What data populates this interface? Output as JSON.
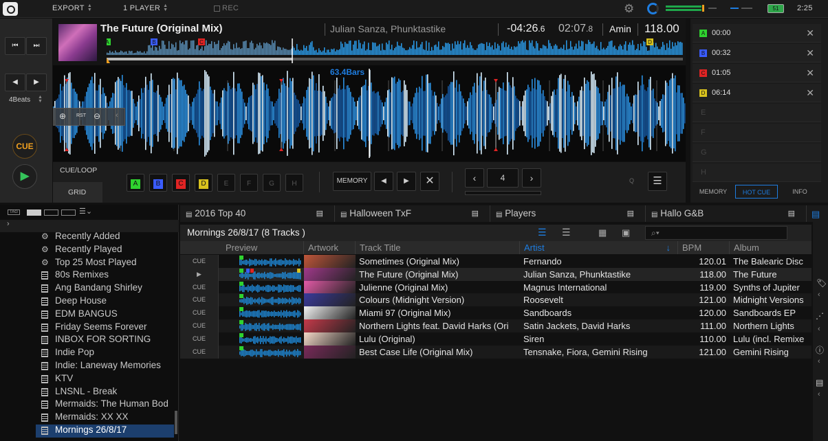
{
  "topbar": {
    "mode": "EXPORT",
    "players": "1 PLAYER",
    "rec": "REC",
    "clock": "2:25",
    "battery": "51"
  },
  "deck": {
    "beats_label": "4Beats",
    "cue_label": "CUE",
    "title": "The Future (Original Mix)",
    "artist": "Julian Sanza, Phunktastike",
    "remaining_main": "-04:26",
    "remaining_frac": ".6",
    "elapsed_main": "02:07",
    "elapsed_frac": ".8",
    "key": "Amin",
    "bpm": "118.00",
    "bars_label": "63.4Bars",
    "zoom_reset": "RST",
    "tabs": [
      "CUE/LOOP",
      "GRID"
    ],
    "hotcue_buttons": [
      "A",
      "B",
      "C",
      "D",
      "E",
      "F",
      "G",
      "H"
    ],
    "memory_label": "MEMORY",
    "loop_beats": "4",
    "q_label": "Q",
    "overview_markers": [
      "A",
      "B",
      "C",
      "D"
    ]
  },
  "hotcues": [
    {
      "letter": "A",
      "time": "00:00",
      "color": "#2fd22f"
    },
    {
      "letter": "B",
      "time": "00:32",
      "color": "#3a5cff"
    },
    {
      "letter": "C",
      "time": "01:05",
      "color": "#e02424"
    },
    {
      "letter": "D",
      "time": "06:14",
      "color": "#d8c21e"
    },
    {
      "letter": "E",
      "time": ""
    },
    {
      "letter": "F",
      "time": ""
    },
    {
      "letter": "G",
      "time": ""
    },
    {
      "letter": "H",
      "time": ""
    }
  ],
  "panel_tabs": [
    "MEMORY",
    "HOT CUE",
    "INFO"
  ],
  "tree": {
    "tag_label": "TAG",
    "items": [
      {
        "label": "Recently Added",
        "kind": "smart"
      },
      {
        "label": "Recently Played",
        "kind": "smart"
      },
      {
        "label": "Top 25 Most Played",
        "kind": "smart"
      },
      {
        "label": "80s Remixes",
        "kind": "list"
      },
      {
        "label": "Ang Bandang Shirley",
        "kind": "list"
      },
      {
        "label": "Deep House",
        "kind": "list"
      },
      {
        "label": "EDM BANGUS",
        "kind": "list"
      },
      {
        "label": "Friday Seems Forever",
        "kind": "list"
      },
      {
        "label": "INBOX FOR SORTING",
        "kind": "list"
      },
      {
        "label": "Indie Pop",
        "kind": "list"
      },
      {
        "label": "Indie: Laneway Memories",
        "kind": "list"
      },
      {
        "label": "KTV",
        "kind": "list"
      },
      {
        "label": "LNSNL - Break",
        "kind": "list"
      },
      {
        "label": "Mermaids: The Human Bod",
        "kind": "list"
      },
      {
        "label": "Mermaids: XX XX",
        "kind": "list"
      },
      {
        "label": "Mornings 26/8/17",
        "kind": "list",
        "selected": true
      }
    ]
  },
  "playlist_tabs": [
    "2016 Top 40",
    "Halloween TxF",
    "Players",
    "Hallo G&B"
  ],
  "list": {
    "title": "Mornings 26/8/17 (8 Tracks )",
    "columns": [
      "Preview",
      "Artwork",
      "Track Title",
      "Artist",
      "BPM",
      "Album"
    ],
    "rows": [
      {
        "cue": "CUE",
        "title": "Sometimes (Original Mix)",
        "artist": "Fernando",
        "bpm": "120.01",
        "album": "The Balearic Disc",
        "art": "#c0563a"
      },
      {
        "cue": "▶",
        "title": "The Future (Original Mix)",
        "artist": "Julian Sanza, Phunktastike",
        "bpm": "118.00",
        "album": "The Future",
        "art": "#a0398a"
      },
      {
        "cue": "CUE",
        "title": "Julienne (Original Mix)",
        "artist": "Magnus International",
        "bpm": "119.00",
        "album": "Synths of Jupiter",
        "art": "#e25aa6"
      },
      {
        "cue": "CUE",
        "title": "Colours (Midnight Version)",
        "artist": "Roosevelt",
        "bpm": "121.00",
        "album": "Midnight Versions",
        "art": "#3a3a9a"
      },
      {
        "cue": "CUE",
        "title": "Miami 97 (Original Mix)",
        "artist": "Sandboards",
        "bpm": "120.00",
        "album": "Sandboards EP",
        "art": "#f2f2f2"
      },
      {
        "cue": "CUE",
        "title": "Northern Lights feat. David Harks (Ori",
        "artist": "Satin Jackets, David Harks",
        "bpm": "111.00",
        "album": "Northern Lights",
        "art": "#c63a4a"
      },
      {
        "cue": "CUE",
        "title": "Lulu (Original)",
        "artist": "Siren",
        "bpm": "110.00",
        "album": "Lulu (incl. Remixe",
        "art": "#f4d8c8"
      },
      {
        "cue": "CUE",
        "title": "Best Case Life (Original Mix)",
        "artist": "Tensnake, Fiora, Gemini Rising",
        "bpm": "121.00",
        "album": "Gemini Rising",
        "art": "#7a2a5a"
      }
    ]
  },
  "colors": {
    "accent": "#1e7de0",
    "cue_orange": "#f0a020",
    "play_green": "#35c35a"
  }
}
